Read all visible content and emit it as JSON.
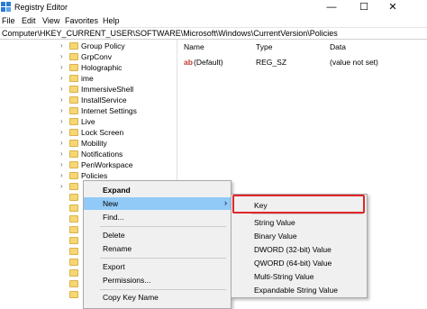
{
  "window": {
    "title": "Registry Editor",
    "minimize": "—",
    "maximize": "☐",
    "close": "✕"
  },
  "menu": [
    "File",
    "Edit",
    "View",
    "Favorites",
    "Help"
  ],
  "address": "Computer\\HKEY_CURRENT_USER\\SOFTWARE\\Microsoft\\Windows\\CurrentVersion\\Policies",
  "tree": [
    "Group Policy",
    "GrpConv",
    "Holographic",
    "ime",
    "ImmersiveShell",
    "InstallService",
    "Internet Settings",
    "Live",
    "Lock Screen",
    "Mobility",
    "Notifications",
    "PenWorkspace",
    "Policies"
  ],
  "list": {
    "headers": [
      "Name",
      "Type",
      "Data"
    ],
    "rows": [
      {
        "icon": "string-value-icon",
        "icon_text": "ab",
        "name": "(Default)",
        "type": "REG_SZ",
        "data": "(value not set)"
      }
    ]
  },
  "context_menu": {
    "expand": "Expand",
    "new": "New",
    "find": "Find...",
    "delete": "Delete",
    "rename": "Rename",
    "export": "Export",
    "permissions": "Permissions...",
    "copy_key_name": "Copy Key Name"
  },
  "submenu": {
    "key": "Key",
    "string_value": "String Value",
    "binary_value": "Binary Value",
    "dword": "DWORD (32-bit) Value",
    "qword": "QWORD (64-bit) Value",
    "multi_string": "Multi-String Value",
    "expandable_string": "Expandable String Value"
  },
  "colors": {
    "menu_highlight": "#91c9f7",
    "annotation_box": "#e0262b",
    "folder": "#f7d674"
  }
}
